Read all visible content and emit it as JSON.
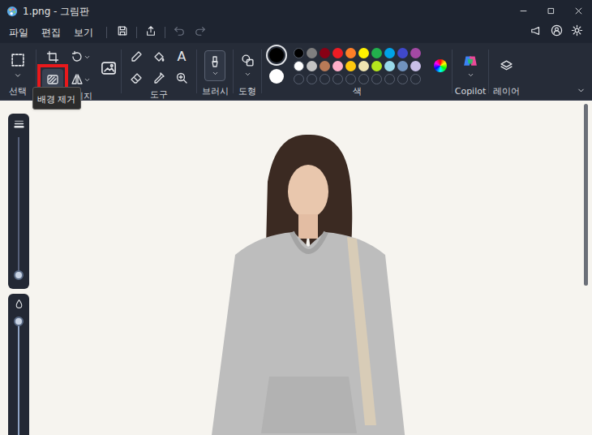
{
  "window": {
    "title": "1.png - 그림판"
  },
  "menu": [
    {
      "label": "파일"
    },
    {
      "label": "편집"
    },
    {
      "label": "보기"
    }
  ],
  "history": {
    "undo_disabled": true,
    "redo_disabled": true
  },
  "ribbon": {
    "groups": [
      {
        "label": "선택"
      },
      {
        "label": "이미지"
      },
      {
        "label": "도구"
      },
      {
        "label": "브러시"
      },
      {
        "label": "도형"
      },
      {
        "label": "색"
      },
      {
        "label": "Copilot"
      },
      {
        "label": "레이어"
      }
    ],
    "text_tool": "A"
  },
  "highlight": {
    "on": true
  },
  "tooltip": {
    "text": "배경 제거"
  },
  "palette": {
    "primary": {
      "color": "#000000",
      "selected": true
    },
    "secondary": {
      "color": "#ffffff",
      "selected": false
    },
    "colors": [
      [
        {
          "color": "#7f7f7f"
        },
        {
          "color": "#880015"
        },
        {
          "color": "#ed1c24"
        },
        {
          "color": "#ff7f27"
        },
        {
          "color": "#fff200"
        },
        {
          "color": "#22b14c"
        },
        {
          "color": "#00a2e8"
        },
        {
          "color": "#3f48cc"
        },
        {
          "color": "#a349a4"
        }
      ],
      [
        {
          "color": "#c3c3c3"
        },
        {
          "color": "#b97a57"
        },
        {
          "color": "#ffaec9"
        },
        {
          "color": "#ffc90e"
        },
        {
          "color": "#efe4b0"
        },
        {
          "color": "#b5e61d"
        },
        {
          "color": "#99d9ea"
        },
        {
          "color": "#7092be"
        },
        {
          "color": "#c8bfe7"
        }
      ]
    ],
    "first_column": [
      {
        "color": "#000000"
      },
      {
        "color": "#ffffff"
      }
    ],
    "custom_slots": [
      {
        "filled": false
      },
      {
        "filled": false
      },
      {
        "filled": false
      },
      {
        "filled": false
      },
      {
        "filled": false
      },
      {
        "filled": false
      },
      {
        "filled": false
      },
      {
        "filled": false
      },
      {
        "filled": false
      },
      {
        "filled": false
      }
    ]
  },
  "left_panel": {
    "sliders": [
      {
        "level": 0.02
      },
      {
        "level": 0.97
      }
    ]
  },
  "scrollbar": {
    "level": 0.55
  }
}
